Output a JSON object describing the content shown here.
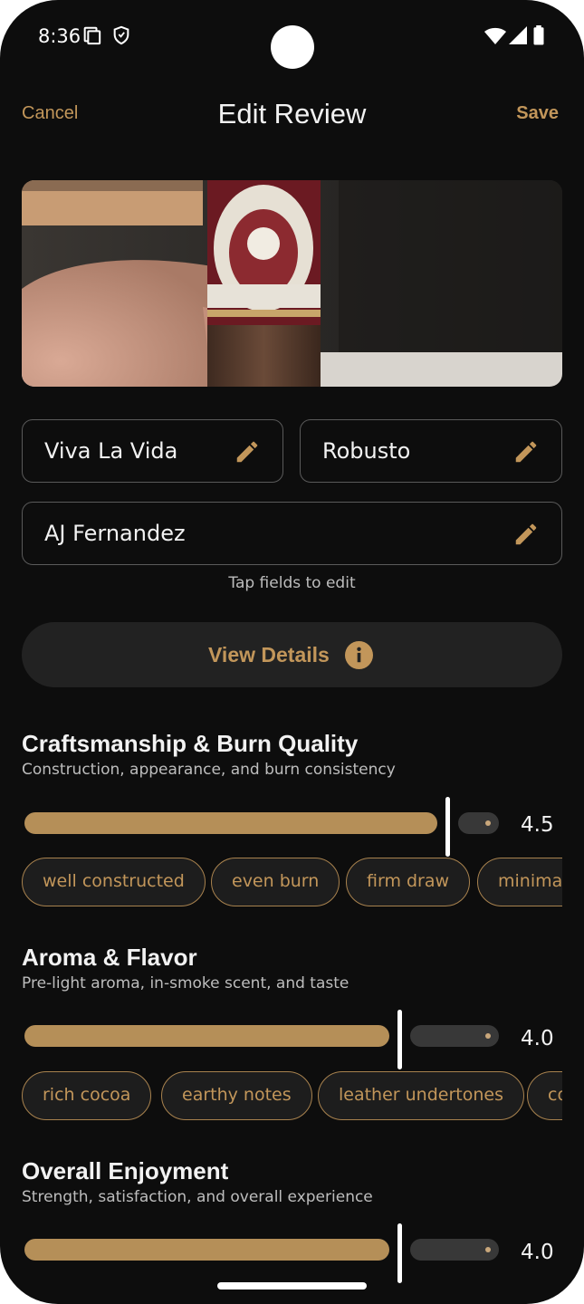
{
  "status_bar": {
    "time": "8:36",
    "icons": [
      "screen-icon",
      "shield-icon",
      "wifi-icon",
      "signal-icon",
      "battery-icon"
    ]
  },
  "top_bar": {
    "cancel_label": "Cancel",
    "title": "Edit Review",
    "save_label": "Save"
  },
  "fields": {
    "cigar_name": "Viva La Vida",
    "vitola": "Robusto",
    "brand": "AJ Fernandez",
    "hint": "Tap fields to edit"
  },
  "details_button": {
    "label": "View Details"
  },
  "ratings": [
    {
      "title": "Craftsmanship & Burn Quality",
      "subtitle": "Construction, appearance, and burn consistency",
      "value": "4.5",
      "fill_fraction": 0.87,
      "tags": [
        "well constructed",
        "even burn",
        "firm draw",
        "minima"
      ]
    },
    {
      "title": "Aroma & Flavor",
      "subtitle": "Pre-light aroma, in-smoke scent, and taste",
      "value": "4.0",
      "fill_fraction": 0.77,
      "tags": [
        "rich cocoa",
        "earthy notes",
        "leather undertones",
        "co"
      ]
    },
    {
      "title": "Overall Enjoyment",
      "subtitle": "Strength, satisfaction, and overall experience",
      "value": "4.0",
      "fill_fraction": 0.77,
      "tags": []
    }
  ],
  "colors": {
    "accent": "#c2965a",
    "background": "#0d0d0d",
    "slider_fill": "#b58f58"
  }
}
